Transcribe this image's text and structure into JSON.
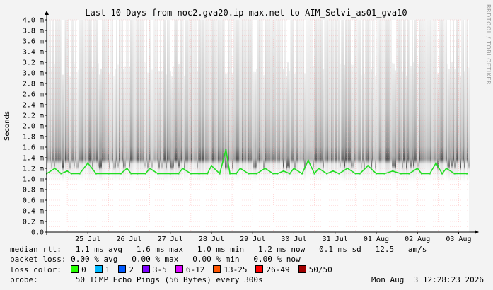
{
  "chart_data": {
    "type": "line",
    "title": "Last 10 Days from noc2.gva20.ip-max.net to AIM_Selvi_as01_gva10",
    "ylabel": "Seconds",
    "xlabel": "",
    "ylim": [
      0,
      4.0
    ],
    "y_unit": "ms",
    "y_ticks": [
      "0.0",
      "0.2 m",
      "0.4 m",
      "0.6 m",
      "0.8 m",
      "1.0 m",
      "1.2 m",
      "1.4 m",
      "1.6 m",
      "1.8 m",
      "2.0 m",
      "2.2 m",
      "2.4 m",
      "2.6 m",
      "2.8 m",
      "3.0 m",
      "3.2 m",
      "3.4 m",
      "3.6 m",
      "3.8 m",
      "4.0 m"
    ],
    "x_ticks": [
      "25 Jul",
      "26 Jul",
      "27 Jul",
      "28 Jul",
      "29 Jul",
      "30 Jul",
      "31 Jul",
      "01 Aug",
      "02 Aug",
      "03 Aug"
    ],
    "xlim_days": [
      0,
      10.25
    ],
    "grid": true,
    "series": [
      {
        "name": "median rtt",
        "color": "#22dd22",
        "x": [
          0.0,
          0.2,
          0.35,
          0.5,
          0.6,
          0.8,
          1.0,
          1.2,
          1.5,
          1.8,
          1.95,
          2.05,
          2.2,
          2.4,
          2.5,
          2.7,
          3.0,
          3.2,
          3.3,
          3.5,
          3.7,
          3.9,
          4.0,
          4.2,
          4.35,
          4.45,
          4.6,
          4.7,
          4.9,
          5.1,
          5.3,
          5.5,
          5.6,
          5.75,
          5.9,
          6.0,
          6.2,
          6.35,
          6.5,
          6.6,
          6.8,
          6.95,
          7.1,
          7.3,
          7.5,
          7.6,
          7.8,
          8.0,
          8.2,
          8.4,
          8.6,
          8.8,
          9.0,
          9.1,
          9.3,
          9.45,
          9.6,
          9.7,
          9.9,
          10.2
        ],
        "values": [
          1.1,
          1.2,
          1.1,
          1.15,
          1.1,
          1.1,
          1.3,
          1.1,
          1.1,
          1.1,
          1.2,
          1.1,
          1.1,
          1.1,
          1.2,
          1.1,
          1.1,
          1.1,
          1.2,
          1.1,
          1.1,
          1.1,
          1.25,
          1.1,
          1.55,
          1.1,
          1.1,
          1.2,
          1.1,
          1.1,
          1.2,
          1.1,
          1.1,
          1.15,
          1.1,
          1.2,
          1.1,
          1.35,
          1.1,
          1.2,
          1.1,
          1.15,
          1.1,
          1.2,
          1.1,
          1.1,
          1.25,
          1.1,
          1.1,
          1.15,
          1.1,
          1.1,
          1.2,
          1.1,
          1.1,
          1.3,
          1.1,
          1.2,
          1.1,
          1.1
        ]
      }
    ]
  },
  "stats": {
    "median_label": "median rtt:",
    "median_values": "1.1 ms avg   1.6 ms max   1.0 ms min   1.2 ms now   0.1 ms sd   12.5   am/s",
    "loss_label": "packet loss:",
    "loss_values": "0.00 % avg   0.00 % max   0.00 % min   0.00 % now",
    "color_label": "loss color:",
    "loss_colors": [
      {
        "label": "0",
        "color": "#26ff00"
      },
      {
        "label": "1",
        "color": "#00b8ff"
      },
      {
        "label": "2",
        "color": "#0059ff"
      },
      {
        "label": "3-5",
        "color": "#7e00ff"
      },
      {
        "label": "6-12",
        "color": "#dd00ff"
      },
      {
        "label": "13-25",
        "color": "#ff5500"
      },
      {
        "label": "26-49",
        "color": "#ff0000"
      },
      {
        "label": "50/50",
        "color": "#a10000"
      }
    ],
    "probe_label": "probe:",
    "probe_text": "50 ICMP Echo Pings (56 Bytes) every 300s",
    "timestamp": "Mon Aug  3 12:28:23 2026"
  },
  "watermark": "RRDTOOL / TOBI OETIKER"
}
